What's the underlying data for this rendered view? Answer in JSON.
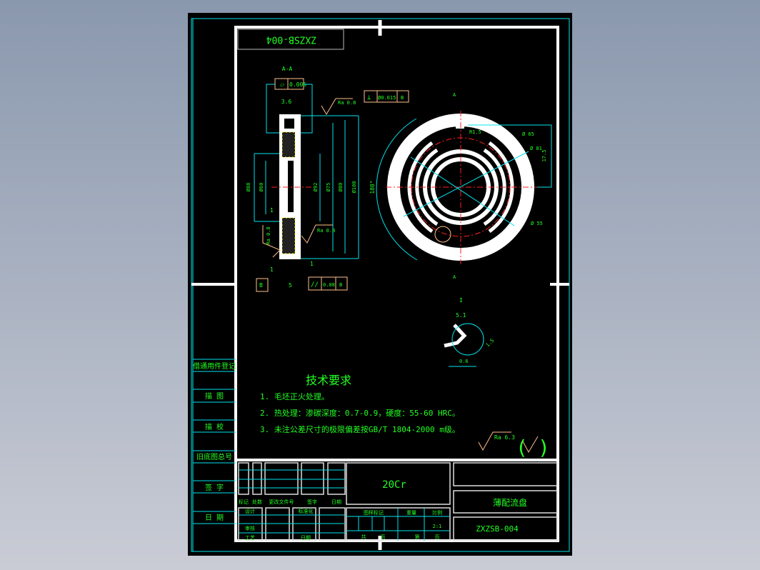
{
  "colors": {
    "sheet": "#000000",
    "frame": "#ffffff",
    "dimension": "#00e5ee",
    "text": "#22ff22",
    "center_line": "#ff2020",
    "symbol": "#ffc08a",
    "hatch": "#ffff00"
  },
  "header": {
    "drawing_code_rotated": "ZXZSB-004"
  },
  "section_view": {
    "label": "A-A",
    "flatness": "0.005",
    "dim_width_top": "3.6",
    "roughness_top": "Ra 0.8",
    "roughness_mid": "Ra 0.8",
    "roughness_left": "Ra 0.8",
    "dim_1a": "1",
    "dim_1b": "1",
    "dim_1c": "1",
    "dim_5": "5",
    "datum": "B",
    "parallelism": "0.08",
    "parallel_datum": "B",
    "perp_tol": "Ø0.015",
    "perp_datum": "B",
    "diameters": [
      "Ø88",
      "Ø60",
      "Ø92",
      "Ø75",
      "Ø80",
      "Ø100"
    ]
  },
  "front_view": {
    "section_mark": "A",
    "angle": "180°",
    "radius": "R1.5",
    "dia_1": "Ø 65",
    "dia_2": "Ø 81",
    "dia_3": "Ø 55",
    "dim_175": "17.5"
  },
  "detail_view": {
    "label": "I",
    "dim_51": "5.1",
    "dim_06": "0.6",
    "dim_15": "1.5"
  },
  "tech_requirements": {
    "title": "技术要求",
    "items": [
      "1. 毛坯正火处理。",
      "2. 热处理：渗碳深度：0.7-0.9，硬度：55-60 HRC。",
      "3. 未注公差尺寸的极限偏差按GB/T 1804-2000 m级。"
    ]
  },
  "roughness_general": "Ra 6.3",
  "side_labels": [
    "借通用件登记",
    "描 图",
    "描 校",
    "旧底图总号",
    "签 字",
    "日 期"
  ],
  "title_block": {
    "material": "20Cr",
    "part_name": "薄配流盘",
    "drawing_no": "ZXZSB-004",
    "change_row": [
      "标记",
      "处数",
      "更改文件号",
      "签字",
      "日期"
    ],
    "design": "设计",
    "standardization": "标准化",
    "review": "审核",
    "process": "工艺",
    "date": "日期",
    "sample_mark": "图样标记",
    "weight": "重量",
    "scale_label": "比例",
    "scale": "2:1",
    "total": "共",
    "page": "页",
    "nth": "第",
    "page2": "页"
  }
}
